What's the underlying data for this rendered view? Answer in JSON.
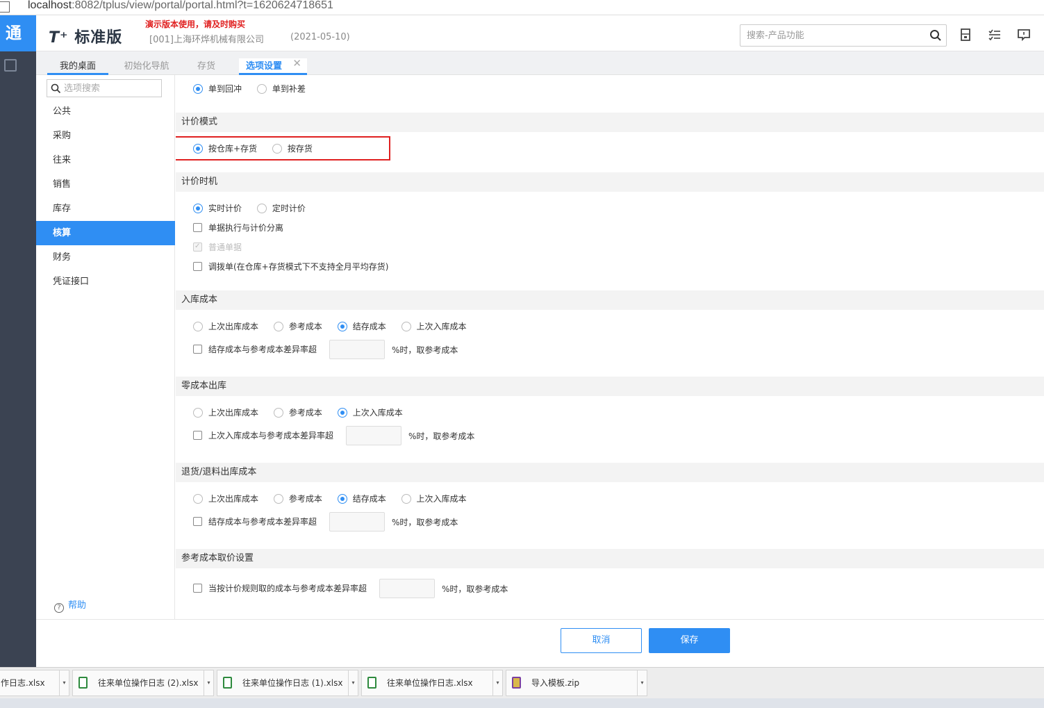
{
  "browser": {
    "url_host": "localhost",
    "url_rest": ":8082/tplus/view/portal/portal.html?t=1620624718651"
  },
  "rail": {
    "brand": "通"
  },
  "header": {
    "logo_mark": "T⁺",
    "logo_text": "标准版",
    "demo_warning": "演示版本使用，请及时购买",
    "company": "[001]上海环烨机械有限公司",
    "date": "(2021-05-10)",
    "search_placeholder": "搜索-产品功能"
  },
  "tabs": [
    {
      "label": "我的桌面"
    },
    {
      "label": "初始化导航"
    },
    {
      "label": "存货"
    },
    {
      "label": "选项设置"
    }
  ],
  "sidebar": {
    "search_placeholder": "选项搜索",
    "items": [
      {
        "label": "公共"
      },
      {
        "label": "采购"
      },
      {
        "label": "往来"
      },
      {
        "label": "销售"
      },
      {
        "label": "库存"
      },
      {
        "label": "核算",
        "active": true
      },
      {
        "label": "财务"
      },
      {
        "label": "凭证接口"
      }
    ],
    "help": "帮助"
  },
  "sections": {
    "top": {
      "opt1": "单到回冲",
      "opt2": "单到补差"
    },
    "pricing_mode": {
      "title": "计价模式",
      "opt1": "按仓库+存货",
      "opt2": "按存货"
    },
    "pricing_timing": {
      "title": "计价时机",
      "opt1": "实时计价",
      "opt2": "定时计价",
      "chk1": "单据执行与计价分离",
      "chk2": "普通单据",
      "chk3": "调拨单(在仓库+存货模式下不支持全月平均存货)"
    },
    "inbound_cost": {
      "title": "入库成本",
      "opt1": "上次出库成本",
      "opt2": "参考成本",
      "opt3": "结存成本",
      "opt4": "上次入库成本",
      "chk": "结存成本与参考成本差异率超",
      "suffix": "%时，取参考成本"
    },
    "zero_cost": {
      "title": "零成本出库",
      "opt1": "上次出库成本",
      "opt2": "参考成本",
      "opt3": "上次入库成本",
      "chk": "上次入库成本与参考成本差异率超",
      "suffix": "%时，取参考成本"
    },
    "return_cost": {
      "title": "退货/退料出库成本",
      "opt1": "上次出库成本",
      "opt2": "参考成本",
      "opt3": "结存成本",
      "opt4": "上次入库成本",
      "chk": "结存成本与参考成本差异率超",
      "suffix": "%时，取参考成本"
    },
    "ref_cost": {
      "title": "参考成本取价设置",
      "chk": "当按计价规则取的成本与参考成本差异率超",
      "suffix": "%时，取参考成本"
    }
  },
  "footer": {
    "cancel": "取消",
    "save": "保存"
  },
  "downloads": [
    {
      "name": "作日志.xlsx"
    },
    {
      "name": "往来单位操作日志 (2).xlsx"
    },
    {
      "name": "往来单位操作日志 (1).xlsx"
    },
    {
      "name": "往来单位操作日志.xlsx"
    },
    {
      "name": "导入模板.zip"
    }
  ],
  "colors": {
    "accent": "#2f8ef3",
    "highlight": "#e02020",
    "rail": "#3b4352"
  }
}
